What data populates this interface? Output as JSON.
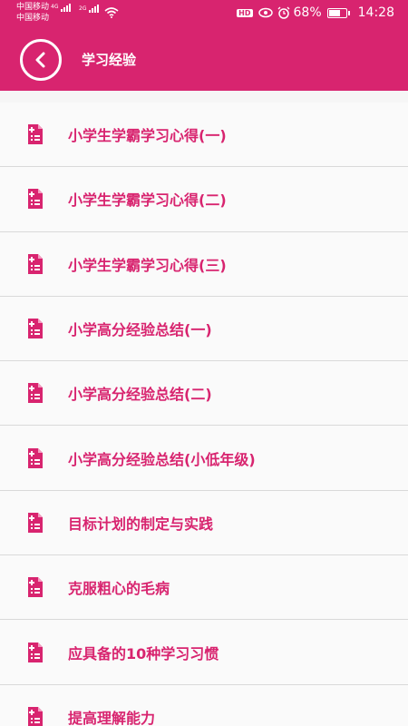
{
  "status_bar": {
    "carrier1": "中国移动",
    "carrier2": "中国移动",
    "net1": "4G",
    "net2": "2G",
    "battery_percent": "68%",
    "time": "14:28",
    "hd": "HD",
    "battery_level": 0.68
  },
  "app_bar": {
    "title": "学习经验",
    "back_icon": "chevron-left-circle-icon"
  },
  "list": {
    "icon": "document-list-icon",
    "items": [
      {
        "label": "小学生学霸学习心得(一)"
      },
      {
        "label": "小学生学霸学习心得(二)"
      },
      {
        "label": "小学生学霸学习心得(三)"
      },
      {
        "label": "小学高分经验总结(一)"
      },
      {
        "label": "小学高分经验总结(二)"
      },
      {
        "label": "小学高分经验总结(小低年级)"
      },
      {
        "label": "目标计划的制定与实践"
      },
      {
        "label": "克服粗心的毛病"
      },
      {
        "label": "应具备的10种学习习惯"
      },
      {
        "label": "提高理解能力"
      }
    ]
  },
  "colors": {
    "primary": "#d8246f",
    "background": "#fafafa",
    "divider": "#d9d9d9"
  }
}
